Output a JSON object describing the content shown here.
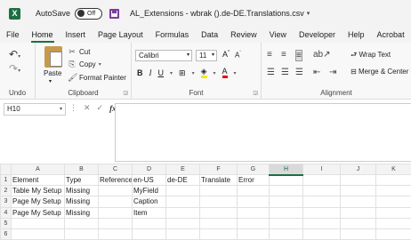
{
  "titlebar": {
    "autosave_label": "AutoSave",
    "toggle_text": "Off",
    "doc_title": "AL_Extensions - wbrak ().de-DE.Translations.csv"
  },
  "menu": [
    "File",
    "Home",
    "Insert",
    "Page Layout",
    "Formulas",
    "Data",
    "Review",
    "View",
    "Developer",
    "Help",
    "Acrobat"
  ],
  "ribbon": {
    "undo_label": "Undo",
    "clipboard": {
      "paste": "Paste",
      "cut": "Cut",
      "copy": "Copy",
      "format_painter": "Format Painter",
      "label": "Clipboard"
    },
    "font": {
      "name": "Calibri",
      "size": "11",
      "label": "Font"
    },
    "alignment": {
      "wrap_text": "Wrap Text",
      "merge_center": "Merge & Center",
      "label": "Alignment"
    }
  },
  "formula_bar": {
    "name_box": "H10"
  },
  "grid": {
    "columns": [
      "A",
      "B",
      "C",
      "D",
      "E",
      "F",
      "G",
      "H",
      "I",
      "J",
      "K"
    ],
    "selected_column": "H",
    "rows": [
      [
        "Element",
        "Type",
        "Reference",
        "en-US",
        "de-DE",
        "Translate",
        "Error",
        "",
        "",
        "",
        ""
      ],
      [
        "Table My Setup",
        "Missing",
        "",
        "MyField",
        "",
        "",
        "",
        "",
        "",
        "",
        ""
      ],
      [
        "Page My Setup",
        "Missing",
        "",
        "Caption",
        "",
        "",
        "",
        "",
        "",
        "",
        ""
      ],
      [
        "Page My Setup",
        "Missing",
        "",
        "Item",
        "",
        "",
        "",
        "",
        "",
        "",
        ""
      ],
      [
        "",
        "",
        "",
        "",
        "",
        "",
        "",
        "",
        "",
        "",
        ""
      ],
      [
        "",
        "",
        "",
        "",
        "",
        "",
        "",
        "",
        "",
        "",
        ""
      ]
    ]
  }
}
